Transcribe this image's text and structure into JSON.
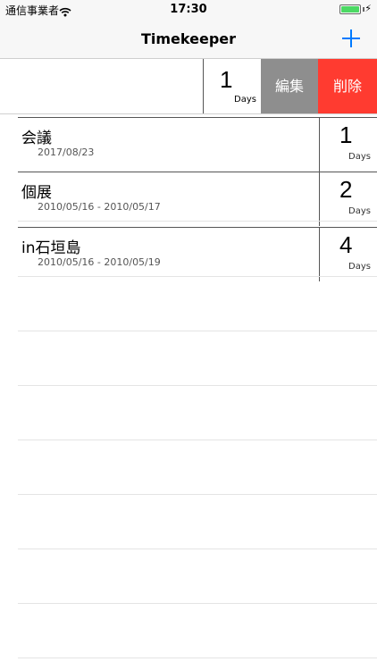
{
  "status_bar": {
    "carrier": "通信事業者",
    "time": "17:30",
    "battery_level": 1.0,
    "battery_color": "#4cd964"
  },
  "nav": {
    "title": "Timekeeper",
    "add_icon": "plus-icon",
    "accent": "#007aff"
  },
  "swiped_row": {
    "days": "1",
    "days_label": "Days",
    "edit_label": "編集",
    "delete_label": "削除",
    "edit_color": "#8e8e8e",
    "delete_color": "#ff3b30"
  },
  "items": [
    {
      "title": "会議",
      "date": "2017/08/23",
      "days": "1",
      "days_label": "Days"
    },
    {
      "title": "個展",
      "date": "2010/05/16 - 2010/05/17",
      "days": "2",
      "days_label": "Days"
    },
    {
      "title": "in石垣島",
      "date": "2010/05/16 - 2010/05/19",
      "days": "4",
      "days_label": "Days"
    }
  ]
}
